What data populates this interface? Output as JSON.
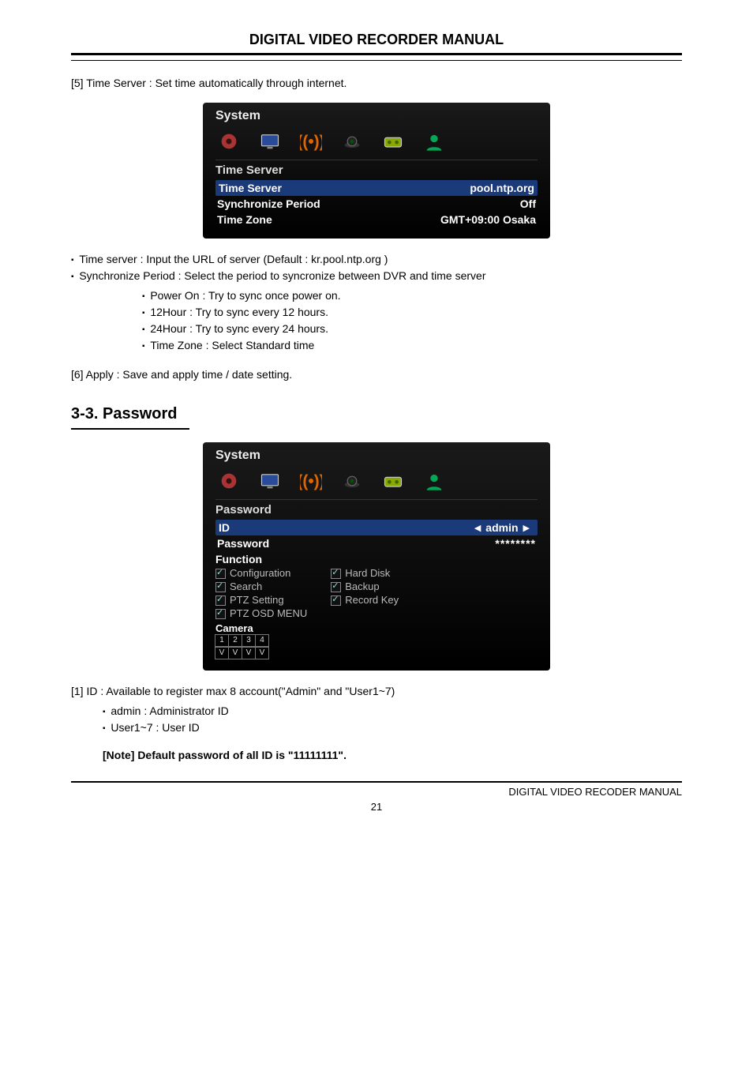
{
  "header": {
    "title": "DIGITAL VIDEO RECORDER MANUAL"
  },
  "intro5": "[5] Time Server : Set time automatically through internet.",
  "panel1": {
    "system": "System",
    "subhead": "Time Server",
    "row_server": {
      "label": "Time Server",
      "value": "pool.ntp.org"
    },
    "row_sync": {
      "label": "Synchronize Period",
      "value": "Off"
    },
    "row_zone": {
      "label": "Time Zone",
      "value": "GMT+09:00 Osaka"
    }
  },
  "bullets_main": [
    "Time server   : Input the URL of server (Default : kr.pool.ntp.org )",
    "Synchronize Period : Select the period to syncronize between DVR and time server"
  ],
  "bullets_sub": [
    "Power On : Try to sync once power on.",
    "12Hour : Try to sync every 12 hours.",
    "24Hour : Try to sync every 24 hours.",
    "Time Zone : Select Standard time"
  ],
  "intro6": "[6] Apply : Save and apply time / date setting.",
  "section33": "3-3. Password",
  "panel2": {
    "system": "System",
    "subhead": "Password",
    "row_id": {
      "label": "ID",
      "value": "admin"
    },
    "row_pw": {
      "label": "Password",
      "value": "********"
    },
    "func_label": "Function",
    "funcs_left": [
      "Configuration",
      "Search",
      "PTZ Setting",
      "PTZ OSD MENU"
    ],
    "funcs_right": [
      "Hard Disk",
      "Backup",
      "Record Key"
    ],
    "camera_label": "Camera",
    "cam_head": [
      "1",
      "2",
      "3",
      "4"
    ],
    "cam_row": [
      "V",
      "V",
      "V",
      "V"
    ]
  },
  "id_intro": "[1] ID : Available to register max 8 account(\"Admin\" and \"User1~7)",
  "id_bullets": [
    "admin : Administrator ID",
    "User1~7 : User ID"
  ],
  "note": "[Note] Default password of all ID is \"11111111\".",
  "footer": {
    "right": "DIGITAL VIDEO RECODER MANUAL",
    "page": "21"
  }
}
